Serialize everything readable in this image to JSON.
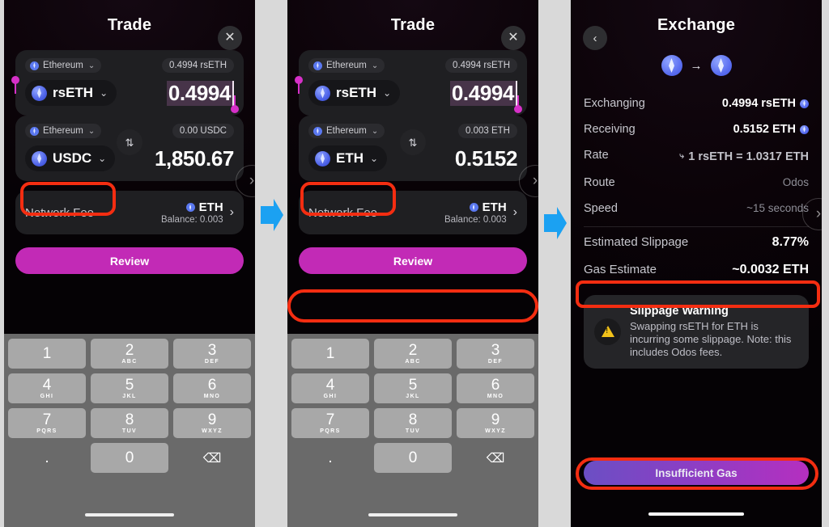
{
  "panels": {
    "trade1": {
      "title": "Trade",
      "close_icon": "close-icon",
      "from": {
        "chain": "Ethereum",
        "balance": "0.4994 rsETH",
        "token": "rsETH",
        "amount": "0.4994"
      },
      "to": {
        "chain": "Ethereum",
        "balance": "0.00 USDC",
        "token": "USDC",
        "amount": "1,850.67"
      },
      "fee": {
        "label": "Network Fee",
        "token": "ETH",
        "balance": "Balance: 0.003"
      },
      "cta": "Review"
    },
    "trade2": {
      "title": "Trade",
      "close_icon": "close-icon",
      "from": {
        "chain": "Ethereum",
        "balance": "0.4994 rsETH",
        "token": "rsETH",
        "amount": "0.4994"
      },
      "to": {
        "chain": "Ethereum",
        "balance": "0.003 ETH",
        "token": "ETH",
        "amount": "0.5152"
      },
      "fee": {
        "label": "Network Fee",
        "token": "ETH",
        "balance": "Balance: 0.003"
      },
      "cta": "Review"
    },
    "exchange": {
      "title": "Exchange",
      "back_icon": "chevron-left-icon",
      "rows": [
        {
          "label": "Exchanging",
          "value": "0.4994 rsETH",
          "badge": true
        },
        {
          "label": "Receiving",
          "value": "0.5152 ETH",
          "badge": true
        },
        {
          "label": "Rate",
          "value": "1 rsETH = 1.0317 ETH",
          "badge": false
        },
        {
          "label": "Route",
          "value": "Odos",
          "badge": false
        },
        {
          "label": "Speed",
          "value": "~15 seconds",
          "badge": false
        }
      ],
      "summary": [
        {
          "label": "Estimated Slippage",
          "value": "8.77%"
        },
        {
          "label": "Gas Estimate",
          "value": "~0.0032 ETH"
        }
      ],
      "warning": {
        "title": "Slippage Warning",
        "body": "Swapping rsETH for ETH is incurring some slippage. Note: this includes Odos fees."
      },
      "cta": "Insufficient Gas"
    }
  },
  "keypad": {
    "keys": [
      {
        "num": "1",
        "abc": ""
      },
      {
        "num": "2",
        "abc": "ABC"
      },
      {
        "num": "3",
        "abc": "DEF"
      },
      {
        "num": "4",
        "abc": "GHI"
      },
      {
        "num": "5",
        "abc": "JKL"
      },
      {
        "num": "6",
        "abc": "MNO"
      },
      {
        "num": "7",
        "abc": "PQRS"
      },
      {
        "num": "8",
        "abc": "TUV"
      },
      {
        "num": "9",
        "abc": "WXYZ"
      }
    ],
    "dot": ".",
    "zero": "0",
    "delete_icon": "backspace-icon"
  },
  "colors": {
    "highlight": "#f42d11",
    "arrow": "#1ba1f2",
    "review": "#c22ab6",
    "eth_blue": "#5a6ef0",
    "warning_yellow": "#f2c21a"
  }
}
